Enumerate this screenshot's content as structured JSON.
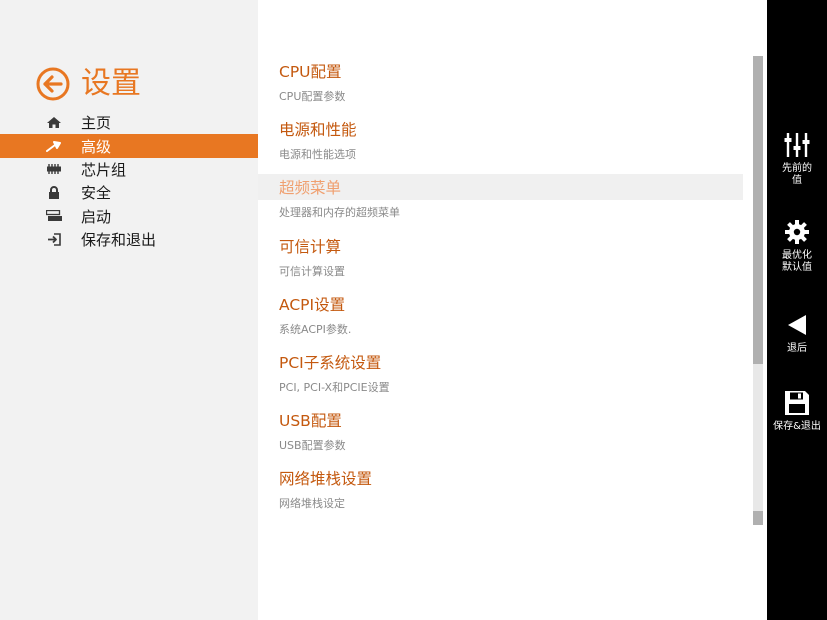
{
  "header": {
    "title": "设置",
    "back_icon": "arrow-left-circle-icon"
  },
  "colors": {
    "accent": "#e87722",
    "menu_title": "#c4590f",
    "sidebar_bg": "#000000",
    "left_panel_bg": "#f2f2f2"
  },
  "nav": {
    "items": [
      {
        "label": "主页",
        "icon": "home-icon",
        "active": false
      },
      {
        "label": "高级",
        "icon": "wrench-icon",
        "active": true
      },
      {
        "label": "芯片组",
        "icon": "chip-icon",
        "active": false
      },
      {
        "label": "安全",
        "icon": "lock-icon",
        "active": false
      },
      {
        "label": "启动",
        "icon": "boot-drive-icon",
        "active": false
      },
      {
        "label": "保存和退出",
        "icon": "exit-icon",
        "active": false
      }
    ]
  },
  "main": {
    "entries": [
      {
        "title": "CPU配置",
        "desc": "CPU配置参数"
      },
      {
        "title": "电源和性能",
        "desc": "电源和性能选项"
      },
      {
        "title": "超频菜单",
        "desc": "处理器和内存的超频菜单",
        "highlighted": true
      },
      {
        "title": "可信计算",
        "desc": "可信计算设置"
      },
      {
        "title": "ACPI设置",
        "desc": "系统ACPI参数."
      },
      {
        "title": "PCI子系统设置",
        "desc": "PCI, PCI-X和PCIE设置"
      },
      {
        "title": "USB配置",
        "desc": "USB配置参数"
      },
      {
        "title": "网络堆栈设置",
        "desc": "网络堆栈设定"
      }
    ]
  },
  "sidebar": {
    "buttons": [
      {
        "label": "先前的\n值",
        "icon": "sliders-icon"
      },
      {
        "label": "最优化\n默认值",
        "icon": "gear-icon"
      },
      {
        "label": "退后",
        "icon": "triangle-left-icon"
      },
      {
        "label": "保存&退出",
        "icon": "floppy-disk-icon"
      }
    ]
  }
}
